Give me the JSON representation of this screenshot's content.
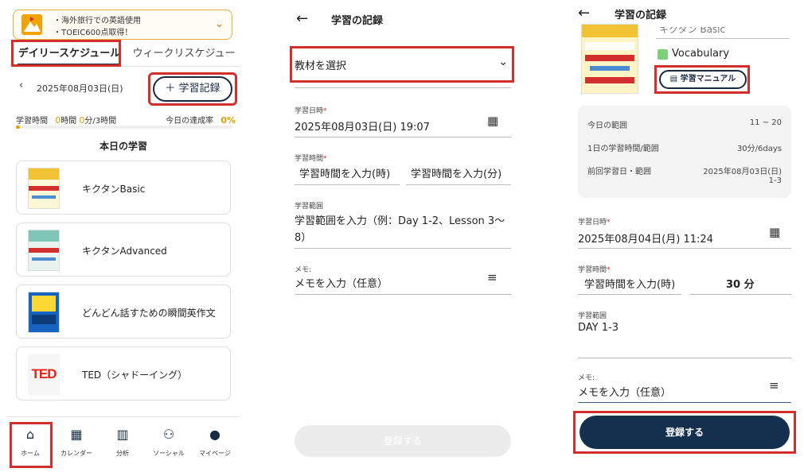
{
  "panel1": {
    "goals": [
      "・海外旅行での英語使用",
      "・TOEIC600点取得！"
    ],
    "tabs": [
      "デイリースケジュール",
      "ウィークリスケジュー"
    ],
    "date": "2025年08月03日(日)",
    "record_button": "＋ 学習記録",
    "stats": {
      "label": "学習時間",
      "hours": "0",
      "hours_unit": "時間",
      "minutes": "0",
      "minutes_unit": "分/3時間",
      "rate_label": "今日の達成率",
      "rate_value": "0%",
      "progress": 0.02
    },
    "section_title": "本日の学習",
    "items": [
      {
        "title": "キクタンBasic"
      },
      {
        "title": "キクタンAdvanced"
      },
      {
        "title": "どんどん話すための瞬間英作文"
      },
      {
        "title": "TED（シャドーイング）",
        "logo": "TED"
      }
    ],
    "nav": [
      {
        "label": "ホーム",
        "icon": "home-icon",
        "glyph": "⌂"
      },
      {
        "label": "カレンダー",
        "icon": "calendar-icon",
        "glyph": "▦"
      },
      {
        "label": "分析",
        "icon": "chart-icon",
        "glyph": "▥"
      },
      {
        "label": "ソーシャル",
        "icon": "people-icon",
        "glyph": "⚇"
      },
      {
        "label": "マイページ",
        "icon": "account-icon",
        "glyph": "●"
      }
    ]
  },
  "panel2": {
    "title": "学習の記録",
    "select_placeholder": "教材を選択",
    "date_label": "学習日時",
    "date_value": "2025年08月03日(日)  19:07",
    "time_label": "学習時間",
    "time_hours_placeholder": "学習時間を入力(時)",
    "time_minutes_placeholder": "学習時間を入力(分)",
    "range_label": "学習範囲",
    "range_placeholder_1": "学習範囲を入力（例：Day 1-2、Lesson 3〜",
    "range_placeholder_2": "8）",
    "memo_label": "メモ:",
    "memo_placeholder": "メモを入力（任意）",
    "submit_label": "登録する"
  },
  "panel3": {
    "title": "学習の記録",
    "selected_text": "キクタン Basic",
    "category": "Vocabulary",
    "category_color": "#7ed07b",
    "manual_button": "学習マニュアル",
    "info": {
      "today_range_label": "今日の範囲",
      "today_range_value": "11 ~ 20",
      "daily_label": "1日の学習時間/範囲",
      "daily_value": "30分/6days",
      "last_label": "前回学習日・範囲",
      "last_value_1": "2025年08月03日(日)",
      "last_value_2": "1-3"
    },
    "date_label": "学習日時",
    "date_value": "2025年08月04日(月)  11:24",
    "time_label": "学習時間",
    "time_hours_placeholder": "学習時間を入力(時)",
    "time_minutes_value": "30 分",
    "range_label": "学習範囲",
    "range_value": "DAY 1-3",
    "memo_label": "メモ:",
    "memo_placeholder": "メモを入力（任意）",
    "submit_label": "登録する"
  }
}
